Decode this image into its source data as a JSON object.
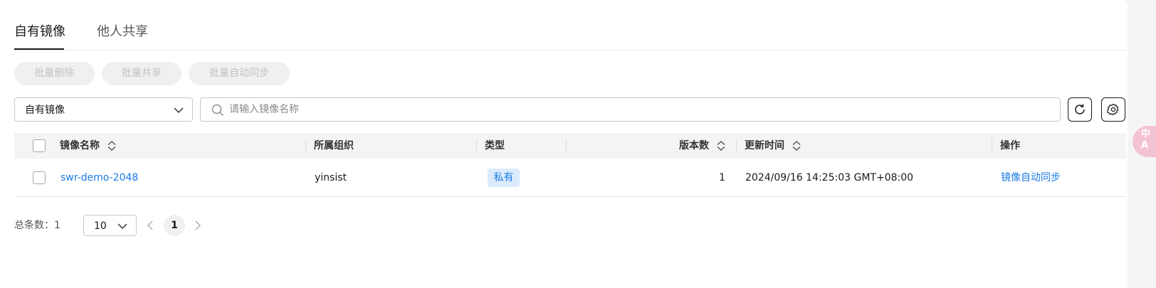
{
  "tabs": [
    {
      "label": "自有镜像",
      "active": true
    },
    {
      "label": "他人共享",
      "active": false
    }
  ],
  "batch_actions": [
    {
      "label": "批量删除",
      "disabled": true
    },
    {
      "label": "批量共享",
      "disabled": true
    },
    {
      "label": "批量自动同步",
      "disabled": true
    }
  ],
  "filter": {
    "select_value": "自有镜像",
    "search_placeholder": "请输入镜像名称",
    "refresh_icon": "refresh-icon",
    "settings_icon": "gear-icon"
  },
  "table": {
    "columns": [
      {
        "label": "镜像名称",
        "sortable": true
      },
      {
        "label": "所属组织",
        "sortable": false
      },
      {
        "label": "类型",
        "sortable": false
      },
      {
        "label": "版本数",
        "sortable": true
      },
      {
        "label": "更新时间",
        "sortable": true
      },
      {
        "label": "操作",
        "sortable": false
      }
    ],
    "rows": [
      {
        "name": "swr-demo-2048",
        "organization": "yinsist",
        "type": "私有",
        "versions": "1",
        "updated": "2024/09/16 14:25:03 GMT+08:00",
        "action": "镜像自动同步"
      }
    ]
  },
  "pagination": {
    "total_label": "总条数：1",
    "page_size": "10",
    "current_page": "1"
  },
  "float_bubble": {
    "text": "中A"
  },
  "colors": {
    "link": "#1a7ce6",
    "tag_bg": "#dcebfb",
    "bubble": "#f4c3d3"
  }
}
